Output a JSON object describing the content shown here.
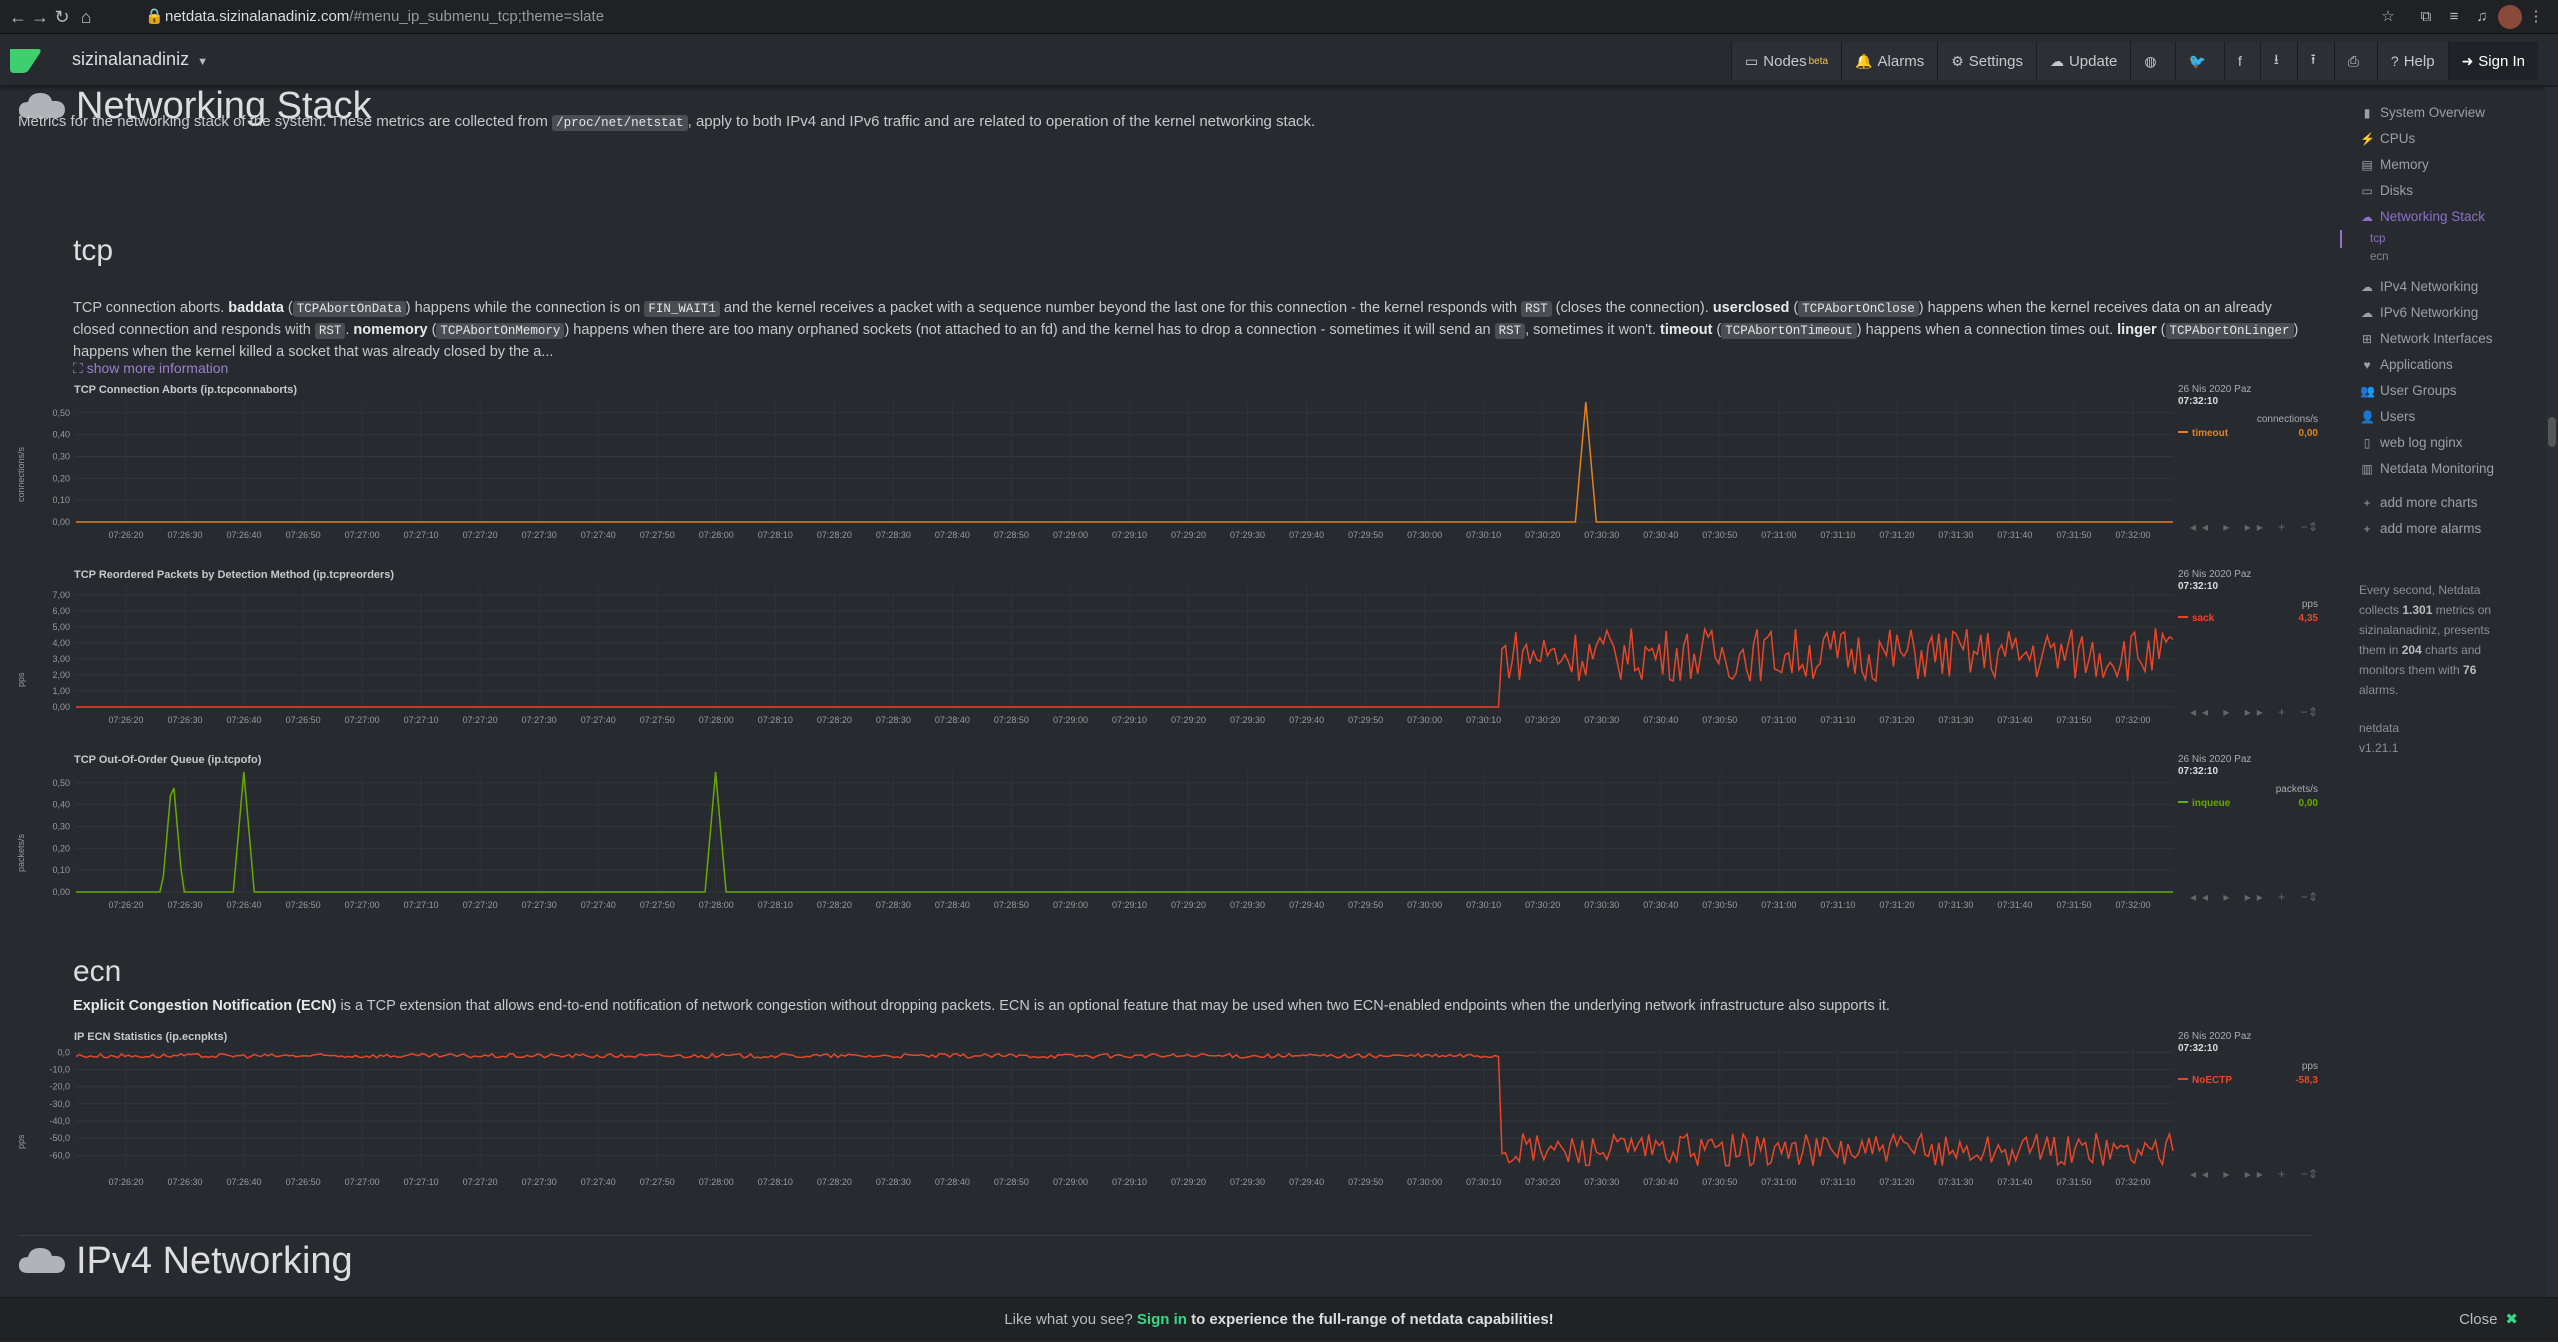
{
  "browser": {
    "url_host": "netdata.sizinalanadiniz.com",
    "url_path": "/#menu_ip_submenu_tcp;theme=slate"
  },
  "navbar": {
    "hostname": "sizinalanadiniz",
    "items": [
      {
        "label": "Nodes",
        "badge": "beta",
        "icon": "monitor-icon"
      },
      {
        "label": "Alarms",
        "icon": "bell-icon"
      },
      {
        "label": "Settings",
        "icon": "gear-icon"
      },
      {
        "label": "Update",
        "icon": "cloud-download-icon"
      },
      {
        "label": "",
        "icon": "github-icon"
      },
      {
        "label": "",
        "icon": "twitter-icon"
      },
      {
        "label": "",
        "icon": "facebook-icon"
      },
      {
        "label": "",
        "icon": "download-icon"
      },
      {
        "label": "",
        "icon": "upload-icon"
      },
      {
        "label": "",
        "icon": "print-icon"
      },
      {
        "label": "Help",
        "icon": "help-icon"
      },
      {
        "label": "Sign In",
        "icon": "sign-in-icon"
      }
    ]
  },
  "section": {
    "title": "Networking Stack",
    "desc_pre": "Metrics for the networking stack of the system. These metrics are collected from ",
    "desc_code": "/proc/net/netstat",
    "desc_post": ", apply to both IPv4 and IPv6 traffic and are related to operation of the kernel networking stack."
  },
  "tcp": {
    "title": "tcp",
    "show_more": "show more information"
  },
  "ecn": {
    "title": "ecn",
    "bold": "Explicit Congestion Notification (ECN)",
    "rest": " is a TCP extension that allows end-to-end notification of network congestion without dropping packets. ECN is an optional feature that may be used when two ECN-enabled endpoints when the underlying network infrastructure also supports it."
  },
  "next_section": {
    "title": "IPv4 Networking"
  },
  "chart_data": [
    {
      "type": "line",
      "title": "TCP Connection Aborts (ip.tcpconnaborts)",
      "ylabel": "connections/s",
      "units": "connections/s",
      "date": "26 Nis 2020 Paz",
      "time": "07:32:10",
      "series": [
        {
          "name": "timeout",
          "value": "0,00",
          "color": "#e5801c"
        }
      ],
      "yticks": [
        "0,50",
        "0,40",
        "0,30",
        "0,20",
        "0,10",
        "0,00"
      ],
      "ylim": [
        0,
        0.55
      ],
      "spikes": [
        [
          0.72,
          0.55
        ]
      ],
      "noise": 0,
      "base": 0,
      "xticks": [
        "07:26:20",
        "07:26:30",
        "07:26:40",
        "07:26:50",
        "07:27:00",
        "07:27:10",
        "07:27:20",
        "07:27:30",
        "07:27:40",
        "07:27:50",
        "07:28:00",
        "07:28:10",
        "07:28:20",
        "07:28:30",
        "07:28:40",
        "07:28:50",
        "07:29:00",
        "07:29:10",
        "07:29:20",
        "07:29:30",
        "07:29:40",
        "07:29:50",
        "07:30:00",
        "07:30:10",
        "07:30:20",
        "07:30:30",
        "07:30:40",
        "07:30:50",
        "07:31:00",
        "07:31:10",
        "07:31:20",
        "07:31:30",
        "07:31:40",
        "07:31:50",
        "07:32:00"
      ]
    },
    {
      "type": "line",
      "title": "TCP Reordered Packets by Detection Method (ip.tcpreorders)",
      "ylabel": "pps",
      "units": "pps",
      "date": "26 Nis 2020 Paz",
      "time": "07:32:10",
      "series": [
        {
          "name": "sack",
          "value": "4,35",
          "color": "#e84628"
        }
      ],
      "yticks": [
        "7,00",
        "6,00",
        "5,00",
        "4,00",
        "3,00",
        "2,00",
        "1,00",
        "0,00"
      ],
      "ylim": [
        0,
        7.5
      ],
      "active_from": 0.68,
      "active_level": 3.3,
      "noise": 1.3,
      "base": 0,
      "xticks": [
        "07:26:20",
        "07:26:30",
        "07:26:40",
        "07:26:50",
        "07:27:00",
        "07:27:10",
        "07:27:20",
        "07:27:30",
        "07:27:40",
        "07:27:50",
        "07:28:00",
        "07:28:10",
        "07:28:20",
        "07:28:30",
        "07:28:40",
        "07:28:50",
        "07:29:00",
        "07:29:10",
        "07:29:20",
        "07:29:30",
        "07:29:40",
        "07:29:50",
        "07:30:00",
        "07:30:10",
        "07:30:20",
        "07:30:30",
        "07:30:40",
        "07:30:50",
        "07:31:00",
        "07:31:10",
        "07:31:20",
        "07:31:30",
        "07:31:40",
        "07:31:50",
        "07:32:00"
      ]
    },
    {
      "type": "line",
      "title": "TCP Out-Of-Order Queue (ip.tcpofo)",
      "ylabel": "packets/s",
      "units": "packets/s",
      "date": "26 Nis 2020 Paz",
      "time": "07:32:10",
      "series": [
        {
          "name": "inqueue",
          "value": "0,00",
          "color": "#66aa00"
        }
      ],
      "yticks": [
        "0,50",
        "0,40",
        "0,30",
        "0,20",
        "0,10",
        "0,00"
      ],
      "ylim": [
        0,
        0.55
      ],
      "spikes": [
        [
          0.046,
          0.55
        ],
        [
          0.08,
          0.55
        ],
        [
          0.305,
          0.55
        ]
      ],
      "noise": 0,
      "base": 0,
      "xticks": [
        "07:26:20",
        "07:26:30",
        "07:26:40",
        "07:26:50",
        "07:27:00",
        "07:27:10",
        "07:27:20",
        "07:27:30",
        "07:27:40",
        "07:27:50",
        "07:28:00",
        "07:28:10",
        "07:28:20",
        "07:28:30",
        "07:28:40",
        "07:28:50",
        "07:29:00",
        "07:29:10",
        "07:29:20",
        "07:29:30",
        "07:29:40",
        "07:29:50",
        "07:30:00",
        "07:30:10",
        "07:30:20",
        "07:30:30",
        "07:30:40",
        "07:30:50",
        "07:31:00",
        "07:31:10",
        "07:31:20",
        "07:31:30",
        "07:31:40",
        "07:31:50",
        "07:32:00"
      ]
    },
    {
      "type": "line",
      "title": "IP ECN Statistics (ip.ecnpkts)",
      "ylabel": "pps",
      "units": "pps",
      "date": "26 Nis 2020 Paz",
      "time": "07:32:10",
      "series": [
        {
          "name": "NoECTP",
          "value": "-58,3",
          "color": "#e84628"
        }
      ],
      "yticks": [
        "0,0",
        "-10,0",
        "-20,0",
        "-30,0",
        "-40,0",
        "-50,0",
        "-60,0"
      ],
      "ylim": [
        -68,
        2
      ],
      "active_from": 0.68,
      "active_level": -57,
      "noise": 2.5,
      "base": -2,
      "xticks": [
        "07:26:20",
        "07:26:30",
        "07:26:40",
        "07:26:50",
        "07:27:00",
        "07:27:10",
        "07:27:20",
        "07:27:30",
        "07:27:40",
        "07:27:50",
        "07:28:00",
        "07:28:10",
        "07:28:20",
        "07:28:30",
        "07:28:40",
        "07:28:50",
        "07:29:00",
        "07:29:10",
        "07:29:20",
        "07:29:30",
        "07:29:40",
        "07:29:50",
        "07:30:00",
        "07:30:10",
        "07:30:20",
        "07:30:30",
        "07:30:40",
        "07:30:50",
        "07:31:00",
        "07:31:10",
        "07:31:20",
        "07:31:30",
        "07:31:40",
        "07:31:50",
        "07:32:00"
      ]
    }
  ],
  "sidebar": {
    "items": [
      {
        "label": "System Overview",
        "icon": "bookmark-icon"
      },
      {
        "label": "CPUs",
        "icon": "bolt-icon"
      },
      {
        "label": "Memory",
        "icon": "database-icon"
      },
      {
        "label": "Disks",
        "icon": "hdd-icon"
      },
      {
        "label": "Networking Stack",
        "icon": "cloud-icon",
        "active": true
      },
      {
        "label": "tcp",
        "sub": true,
        "active": true
      },
      {
        "label": "ecn",
        "sub": true
      },
      {
        "label": "IPv4 Networking",
        "icon": "cloud-icon"
      },
      {
        "label": "IPv6 Networking",
        "icon": "cloud-icon"
      },
      {
        "label": "Network Interfaces",
        "icon": "sitemap-icon"
      },
      {
        "label": "Applications",
        "icon": "heart-icon"
      },
      {
        "label": "User Groups",
        "icon": "users-icon"
      },
      {
        "label": "Users",
        "icon": "user-icon"
      },
      {
        "label": "web log nginx",
        "icon": "file-icon"
      },
      {
        "label": "Netdata Monitoring",
        "icon": "chart-icon"
      },
      {
        "label": "add more charts",
        "icon": "plus-icon"
      },
      {
        "label": "add more alarms",
        "icon": "plus-icon"
      }
    ],
    "info_pre": "Every second, Netdata collects ",
    "info_metrics": "1.301",
    "info_mid": " metrics on sizinalanadiniz, presents them in ",
    "info_charts": "204",
    "info_mid2": " charts and monitors them with ",
    "info_alarms": "76",
    "info_post": " alarms.",
    "brand": "netdata",
    "version": "v1.21.1"
  },
  "footer": {
    "pre": "Like what you see? ",
    "link": "Sign in",
    "post": " to experience the full-range of netdata capabilities!",
    "close": "Close"
  }
}
